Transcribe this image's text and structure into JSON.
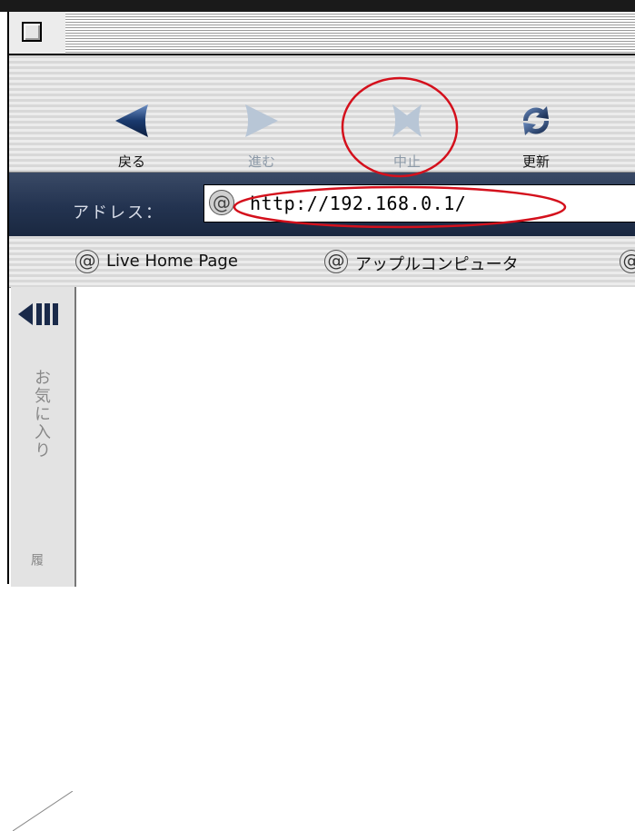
{
  "toolbar": {
    "back_label": "戻る",
    "forward_label": "進む",
    "stop_label": "中止",
    "refresh_label": "更新"
  },
  "address": {
    "label": "アドレス：",
    "value": "http://192.168.0.1/"
  },
  "favorites": {
    "items": [
      {
        "label": "Live Home Page"
      },
      {
        "label": "アップルコンピュータ"
      }
    ]
  },
  "side": {
    "tab_label": "お気に入り",
    "tab2_label": "履"
  },
  "colors": {
    "annotation": "#d4101c",
    "address_bar": "#233350",
    "back_icon": "#1a3a6e",
    "disabled_icon": "#b8c6d6"
  },
  "icons": {
    "back": "left-arrow-icon",
    "forward": "right-arrow-icon",
    "stop": "x-icon",
    "refresh": "refresh-arrows-icon",
    "close": "close-box-icon",
    "at": "at-icon"
  }
}
